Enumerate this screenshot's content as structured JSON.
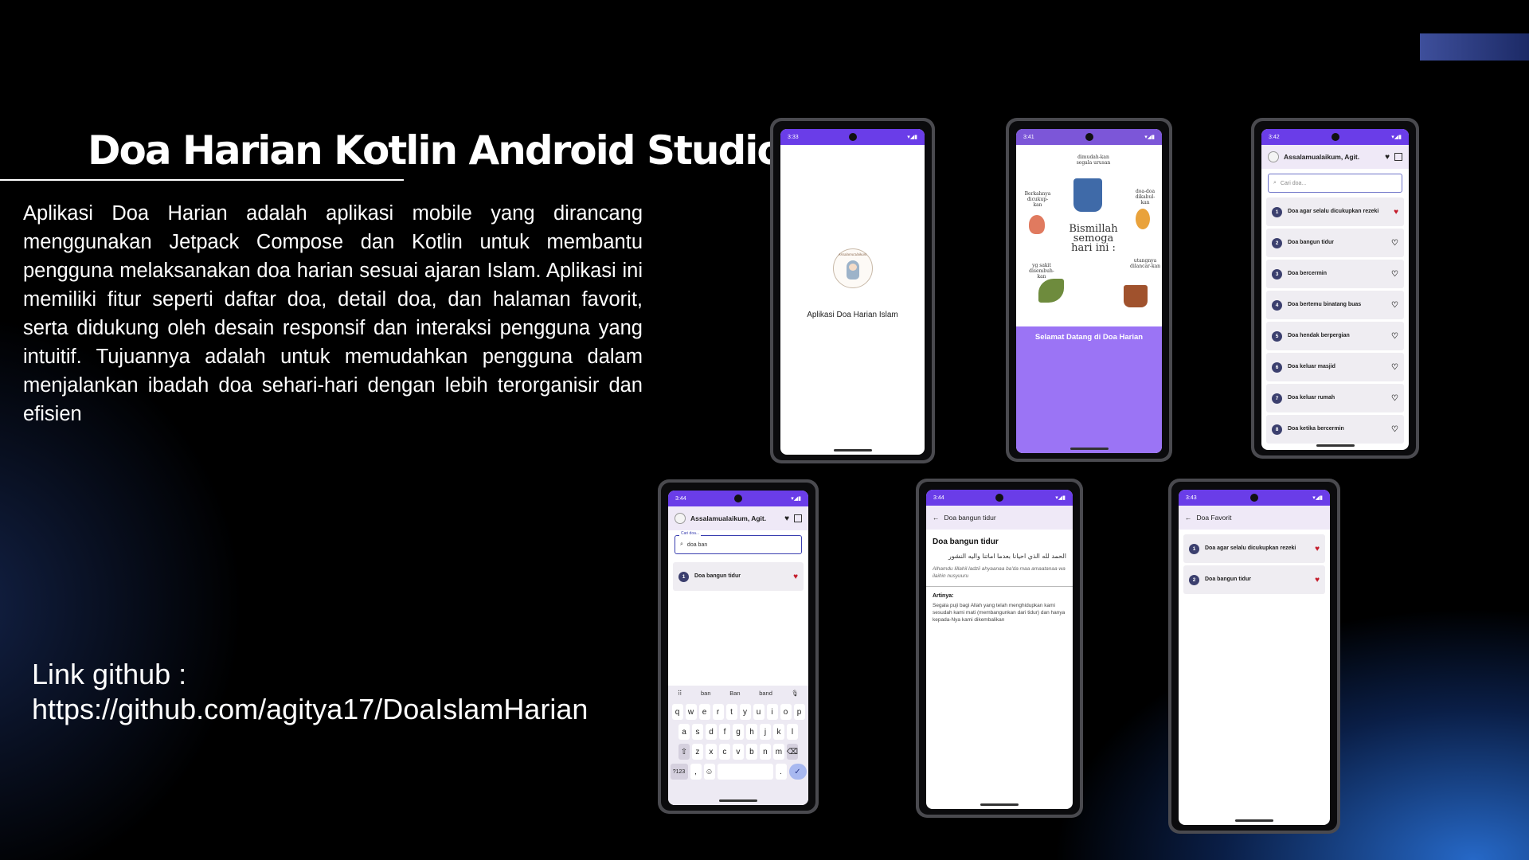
{
  "slide": {
    "title": "Doa Harian Kotlin Android Studio",
    "description": "Aplikasi Doa Harian adalah aplikasi mobile yang dirancang menggunakan Jetpack Compose dan Kotlin untuk membantu pengguna melaksanakan doa harian sesuai ajaran Islam. Aplikasi ini memiliki fitur seperti daftar doa, detail doa, dan halaman favorit, serta didukung oleh desain responsif dan interaksi pengguna yang intuitif. Tujuannya adalah untuk memudahkan pengguna dalam menjalankan ibadah doa sehari-hari dengan lebih terorganisir dan efisien",
    "github_label": "Link github :",
    "github_url": "https://github.com/agitya17/DoaIslamHarian"
  },
  "phones": {
    "splash": {
      "time": "3:33",
      "logo_text": "Assalamu'alaikum",
      "app_name": "Aplikasi Doa Harian Islam"
    },
    "welcome": {
      "time": "3:41",
      "art_top": "dimudah-kan segala urusan",
      "art_left": "Berkahnya dicukup-kan",
      "art_right": "doa-doa dikabul-kan",
      "art_center": "Bismillah semoga hari ini :",
      "art_bottom_left": "yg sakit disembuh-kan",
      "art_bottom_right": "utangnya dilancar-kan",
      "welcome_text": "Selamat Datang di Doa Harian"
    },
    "list": {
      "time": "3:42",
      "greeting": "Assalamualaikum, Agit.",
      "search_placeholder": "Cari doa...",
      "items": [
        {
          "num": "1",
          "label": "Doa agar selalu dicukupkan rezeki",
          "fav": true
        },
        {
          "num": "2",
          "label": "Doa bangun tidur",
          "fav": false
        },
        {
          "num": "3",
          "label": "Doa bercermin",
          "fav": false
        },
        {
          "num": "4",
          "label": "Doa bertemu binatang buas",
          "fav": false
        },
        {
          "num": "5",
          "label": "Doa hendak berpergian",
          "fav": false
        },
        {
          "num": "6",
          "label": "Doa keluar masjid",
          "fav": false
        },
        {
          "num": "7",
          "label": "Doa keluar rumah",
          "fav": false
        },
        {
          "num": "8",
          "label": "Doa ketika bercermin",
          "fav": false
        }
      ]
    },
    "search": {
      "time": "3:44",
      "greeting": "Assalamualaikum, Agit.",
      "search_caption": "Cari doa...",
      "search_value": "doa ban",
      "result": {
        "num": "1",
        "label": "Doa bangun tidur",
        "fav": true
      },
      "suggestions": [
        "ban",
        "Ban",
        "band"
      ],
      "row1": [
        "q",
        "w",
        "e",
        "r",
        "t",
        "y",
        "u",
        "i",
        "o",
        "p"
      ],
      "row2": [
        "a",
        "s",
        "d",
        "f",
        "g",
        "h",
        "j",
        "k",
        "l"
      ],
      "row3": [
        "z",
        "x",
        "c",
        "v",
        "b",
        "n",
        "m"
      ],
      "key_123": "?123",
      "key_comma": ",",
      "key_period": "."
    },
    "detail": {
      "time": "3:44",
      "appbar_title": "Doa bangun tidur",
      "title": "Doa bangun tidur",
      "arabic": "الحمد لله الذي احيانا بعدما اماتنا واليه النشور",
      "latin": "Alhamdu lillahil ladzii ahyaanaa ba'da maa amaatanaa wa ilaihin nusyuuru",
      "meaning_label": "Artinya:",
      "meaning": "Segala puji bagi Allah yang telah menghidupkan kami sesudah kami mati (membangunkan dari tidur) dan hanya kepada-Nya kami dikembalikan"
    },
    "favorites": {
      "time": "3:43",
      "appbar_title": "Doa Favorit",
      "items": [
        {
          "num": "1",
          "label": "Doa agar selalu dicukupkan rezeki"
        },
        {
          "num": "2",
          "label": "Doa bangun tidur"
        }
      ]
    }
  },
  "colors": {
    "status_bar": "#6a3de8",
    "welcome_band": "#9b74f5",
    "fav_heart": "#c41c2a",
    "number_badge": "#3b3f6e"
  }
}
